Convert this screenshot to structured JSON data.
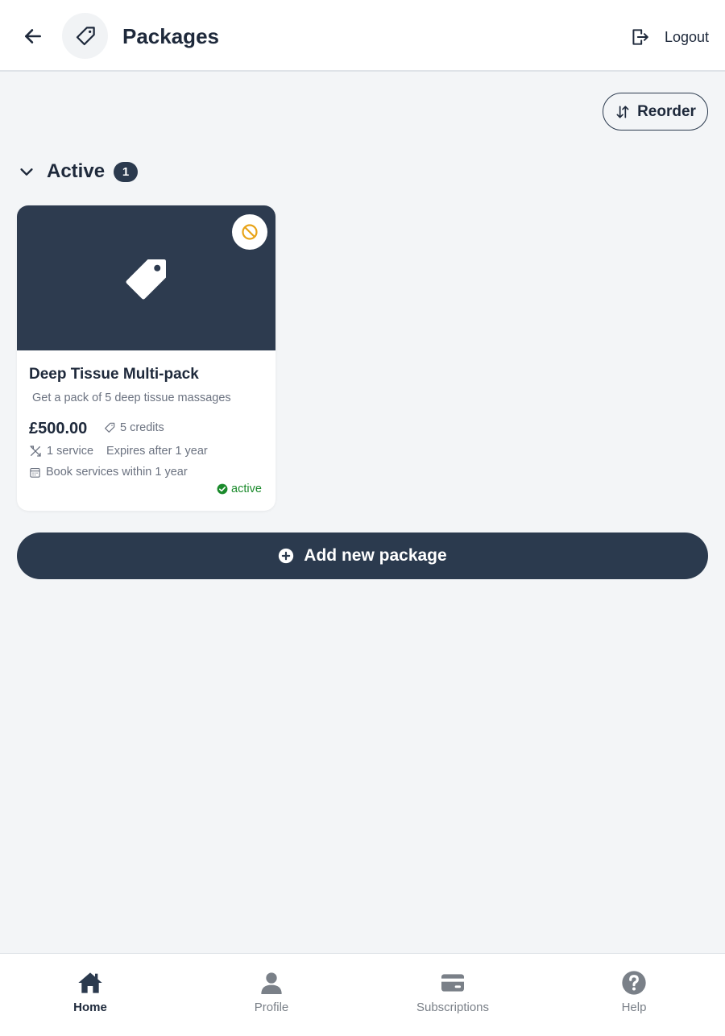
{
  "header": {
    "title": "Packages",
    "logout_label": "Logout"
  },
  "toolbar": {
    "reorder_label": "Reorder"
  },
  "section": {
    "title": "Active",
    "count": "1"
  },
  "package": {
    "name": "Deep Tissue Multi-pack",
    "description": "Get a pack of 5 deep tissue massages",
    "price": "£500.00",
    "credits": "5 credits",
    "services": "1 service",
    "expiry": "Expires after 1 year",
    "booking_window": "Book services within 1 year",
    "status": "active"
  },
  "actions": {
    "add_label": "Add new package"
  },
  "nav": {
    "items": [
      {
        "label": "Home",
        "icon": "home-icon",
        "active": true
      },
      {
        "label": "Profile",
        "icon": "person-icon",
        "active": false
      },
      {
        "label": "Subscriptions",
        "icon": "card-icon",
        "active": false
      },
      {
        "label": "Help",
        "icon": "help-icon",
        "active": false
      }
    ]
  },
  "colors": {
    "primary": "#2b3a4e",
    "background": "#f3f5f7",
    "status_active": "#1a8a2b",
    "warning": "#e8a317"
  }
}
